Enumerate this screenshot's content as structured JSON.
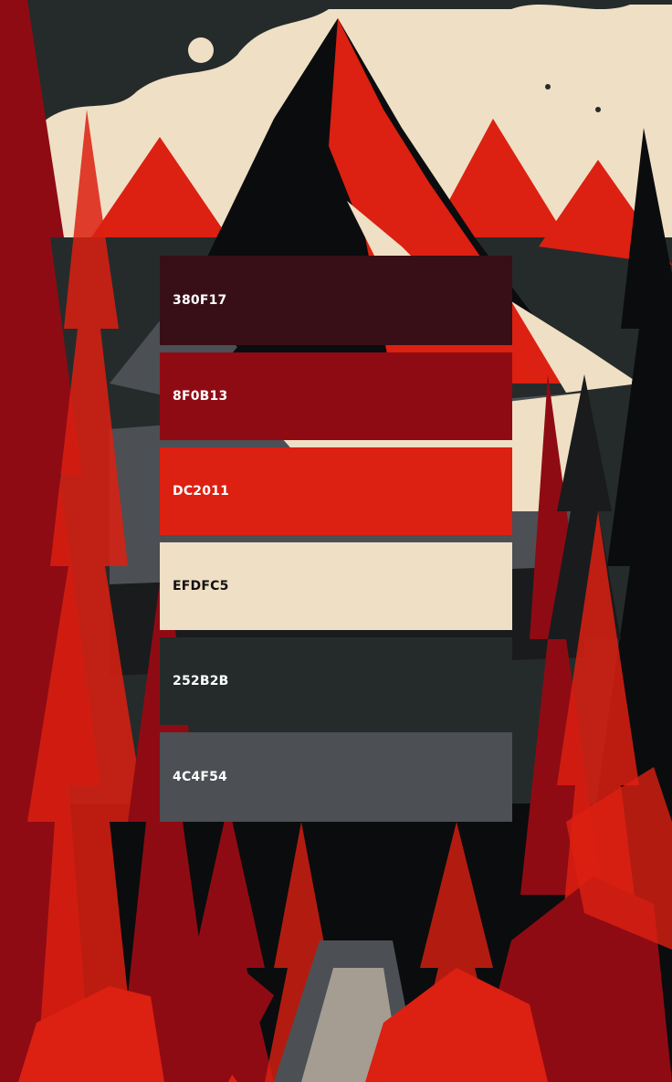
{
  "palette": {
    "swatches": [
      {
        "label": "380F17",
        "color": "#380F17",
        "text_color": "#FFFFFF"
      },
      {
        "label": "8F0B13",
        "color": "#8F0B13",
        "text_color": "#FFFFFF"
      },
      {
        "label": "DC2011",
        "color": "#DC2011",
        "text_color": "#FFFFFF"
      },
      {
        "label": "EFDFC5",
        "color": "#EFDFC5",
        "text_color": "#111111"
      },
      {
        "label": "252B2B",
        "color": "#252B2B",
        "text_color": "#FFFFFF"
      },
      {
        "label": "4C4F54",
        "color": "#4C4F54",
        "text_color": "#FFFFFF"
      }
    ]
  },
  "background": {
    "description_icon": "mountain-forest-illustration",
    "colors": {
      "sky": "#252B2B",
      "cloud": "#EFDFC5",
      "red": "#DC2011",
      "dark_red": "#8F0B13",
      "shadow": "#0b0c0e"
    }
  }
}
